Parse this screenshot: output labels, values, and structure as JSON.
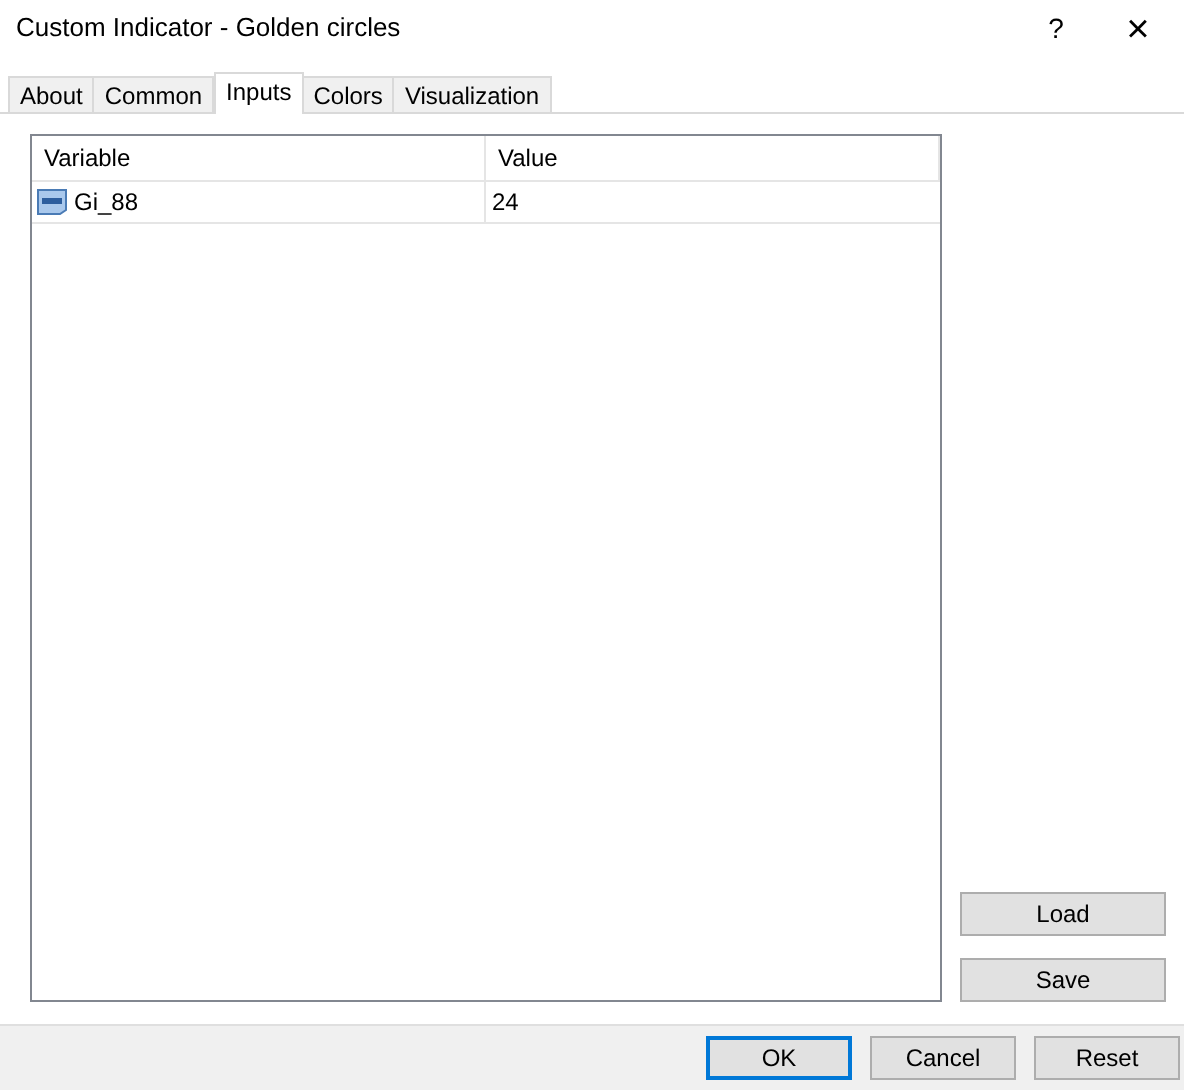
{
  "window": {
    "title": "Custom Indicator - Golden circles",
    "help": "?",
    "close": "×"
  },
  "tabs": [
    {
      "label": "About",
      "selected": false
    },
    {
      "label": "Common",
      "selected": false
    },
    {
      "label": "Inputs",
      "selected": true
    },
    {
      "label": "Colors",
      "selected": false
    },
    {
      "label": "Visualization",
      "selected": false
    }
  ],
  "table": {
    "columns": [
      "Variable",
      "Value"
    ],
    "rows": [
      {
        "variable": "Gi_88",
        "value": "24"
      }
    ]
  },
  "side_buttons": [
    "Load",
    "Save"
  ],
  "footer_buttons": [
    {
      "label": "OK",
      "default": true
    },
    {
      "label": "Cancel",
      "default": false
    },
    {
      "label": "Reset",
      "default": false
    }
  ]
}
